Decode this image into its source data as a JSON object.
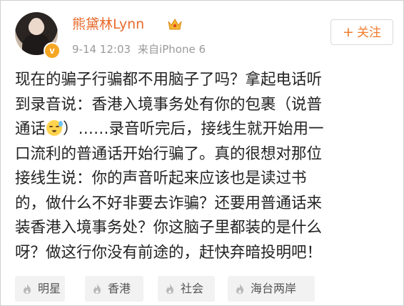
{
  "post": {
    "username": "熊黛林Lynn",
    "date": "9-14 12:03",
    "source": "来自iPhone 6",
    "follow_label": "关注",
    "follow_plus": "+",
    "lines": [
      "现在的骗子行骗都不用脑子了吗？拿起电话听",
      "到录音说：香港入境事务处有你的包裹（说普",
      "通话",
      "）……录音听完后，接线生就开始用一",
      "口流利的普通话开始行骗了。真的很想对那位",
      "接线生说：你的声音听起来应该也是读过书",
      "的，做什么不好非要去诈骗？还要用普通话来",
      "装香港入境事务处？你这脑子里都装的是什么",
      "呀？做这行你没有前途的，赶快弃暗投明吧！"
    ],
    "tags": [
      "明星",
      "香港",
      "社会",
      "海台两岸"
    ]
  },
  "icons": {
    "avatar": "user-avatar",
    "verified": "verified-badge-icon",
    "crown": "crown-icon",
    "emoji": "crying-emoji-icon",
    "tag_icon": "fire-icon"
  },
  "colors": {
    "username": "#e8692a",
    "follow": "#f07b2a",
    "verified": "#f5a623",
    "meta": "#9a9a9a",
    "tag_bg": "#f2f2f2"
  }
}
